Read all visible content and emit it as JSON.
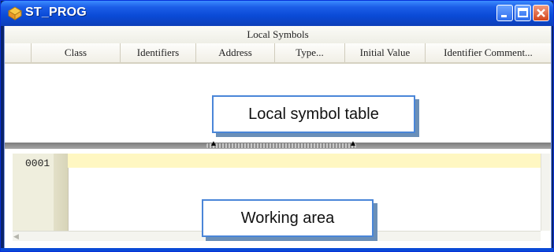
{
  "window": {
    "title": "ST_PROG",
    "icon": "folder-gem-icon",
    "colors": {
      "titlebar": "#0a4ad6",
      "current_line": "#fff7c2",
      "callout_border": "#4a86d8",
      "gutter": "#efeedd"
    }
  },
  "symbol_table": {
    "caption": "Local Symbols",
    "columns": [
      "Class",
      "Identifiers",
      "Address",
      "Type...",
      "Initial Value",
      "Identifier Comment..."
    ]
  },
  "annotations": {
    "symbol_table_label": "Local symbol table",
    "working_area_label": "Working area"
  },
  "editor": {
    "line_numbers": [
      "0001"
    ]
  }
}
